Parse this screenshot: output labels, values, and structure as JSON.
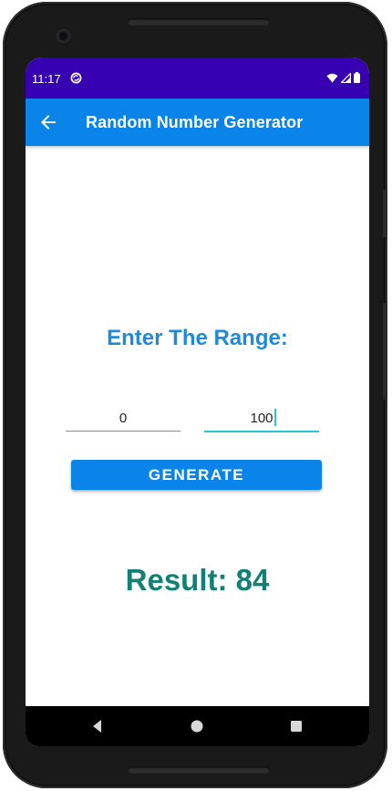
{
  "status_bar": {
    "time": "11:17",
    "left_icons": [
      "sync-icon"
    ],
    "right_icons": [
      "wifi-icon",
      "signal-icon",
      "battery-icon"
    ],
    "color": "#3700b3"
  },
  "app_bar": {
    "title": "Random Number Generator",
    "back_icon": "arrow-back-icon",
    "color": "#0a84e8"
  },
  "main": {
    "heading": "Enter The Range:",
    "min_input": {
      "value": "0"
    },
    "max_input": {
      "value": "100"
    },
    "generate_label": "GENERATE",
    "result_text": "Result: 84"
  },
  "colors": {
    "heading": "#1f8ad6",
    "result": "#138076",
    "input_focus": "#26c6da"
  },
  "nav_bar": {
    "buttons": [
      "back-triangle-icon",
      "home-circle-icon",
      "recents-square-icon"
    ]
  }
}
